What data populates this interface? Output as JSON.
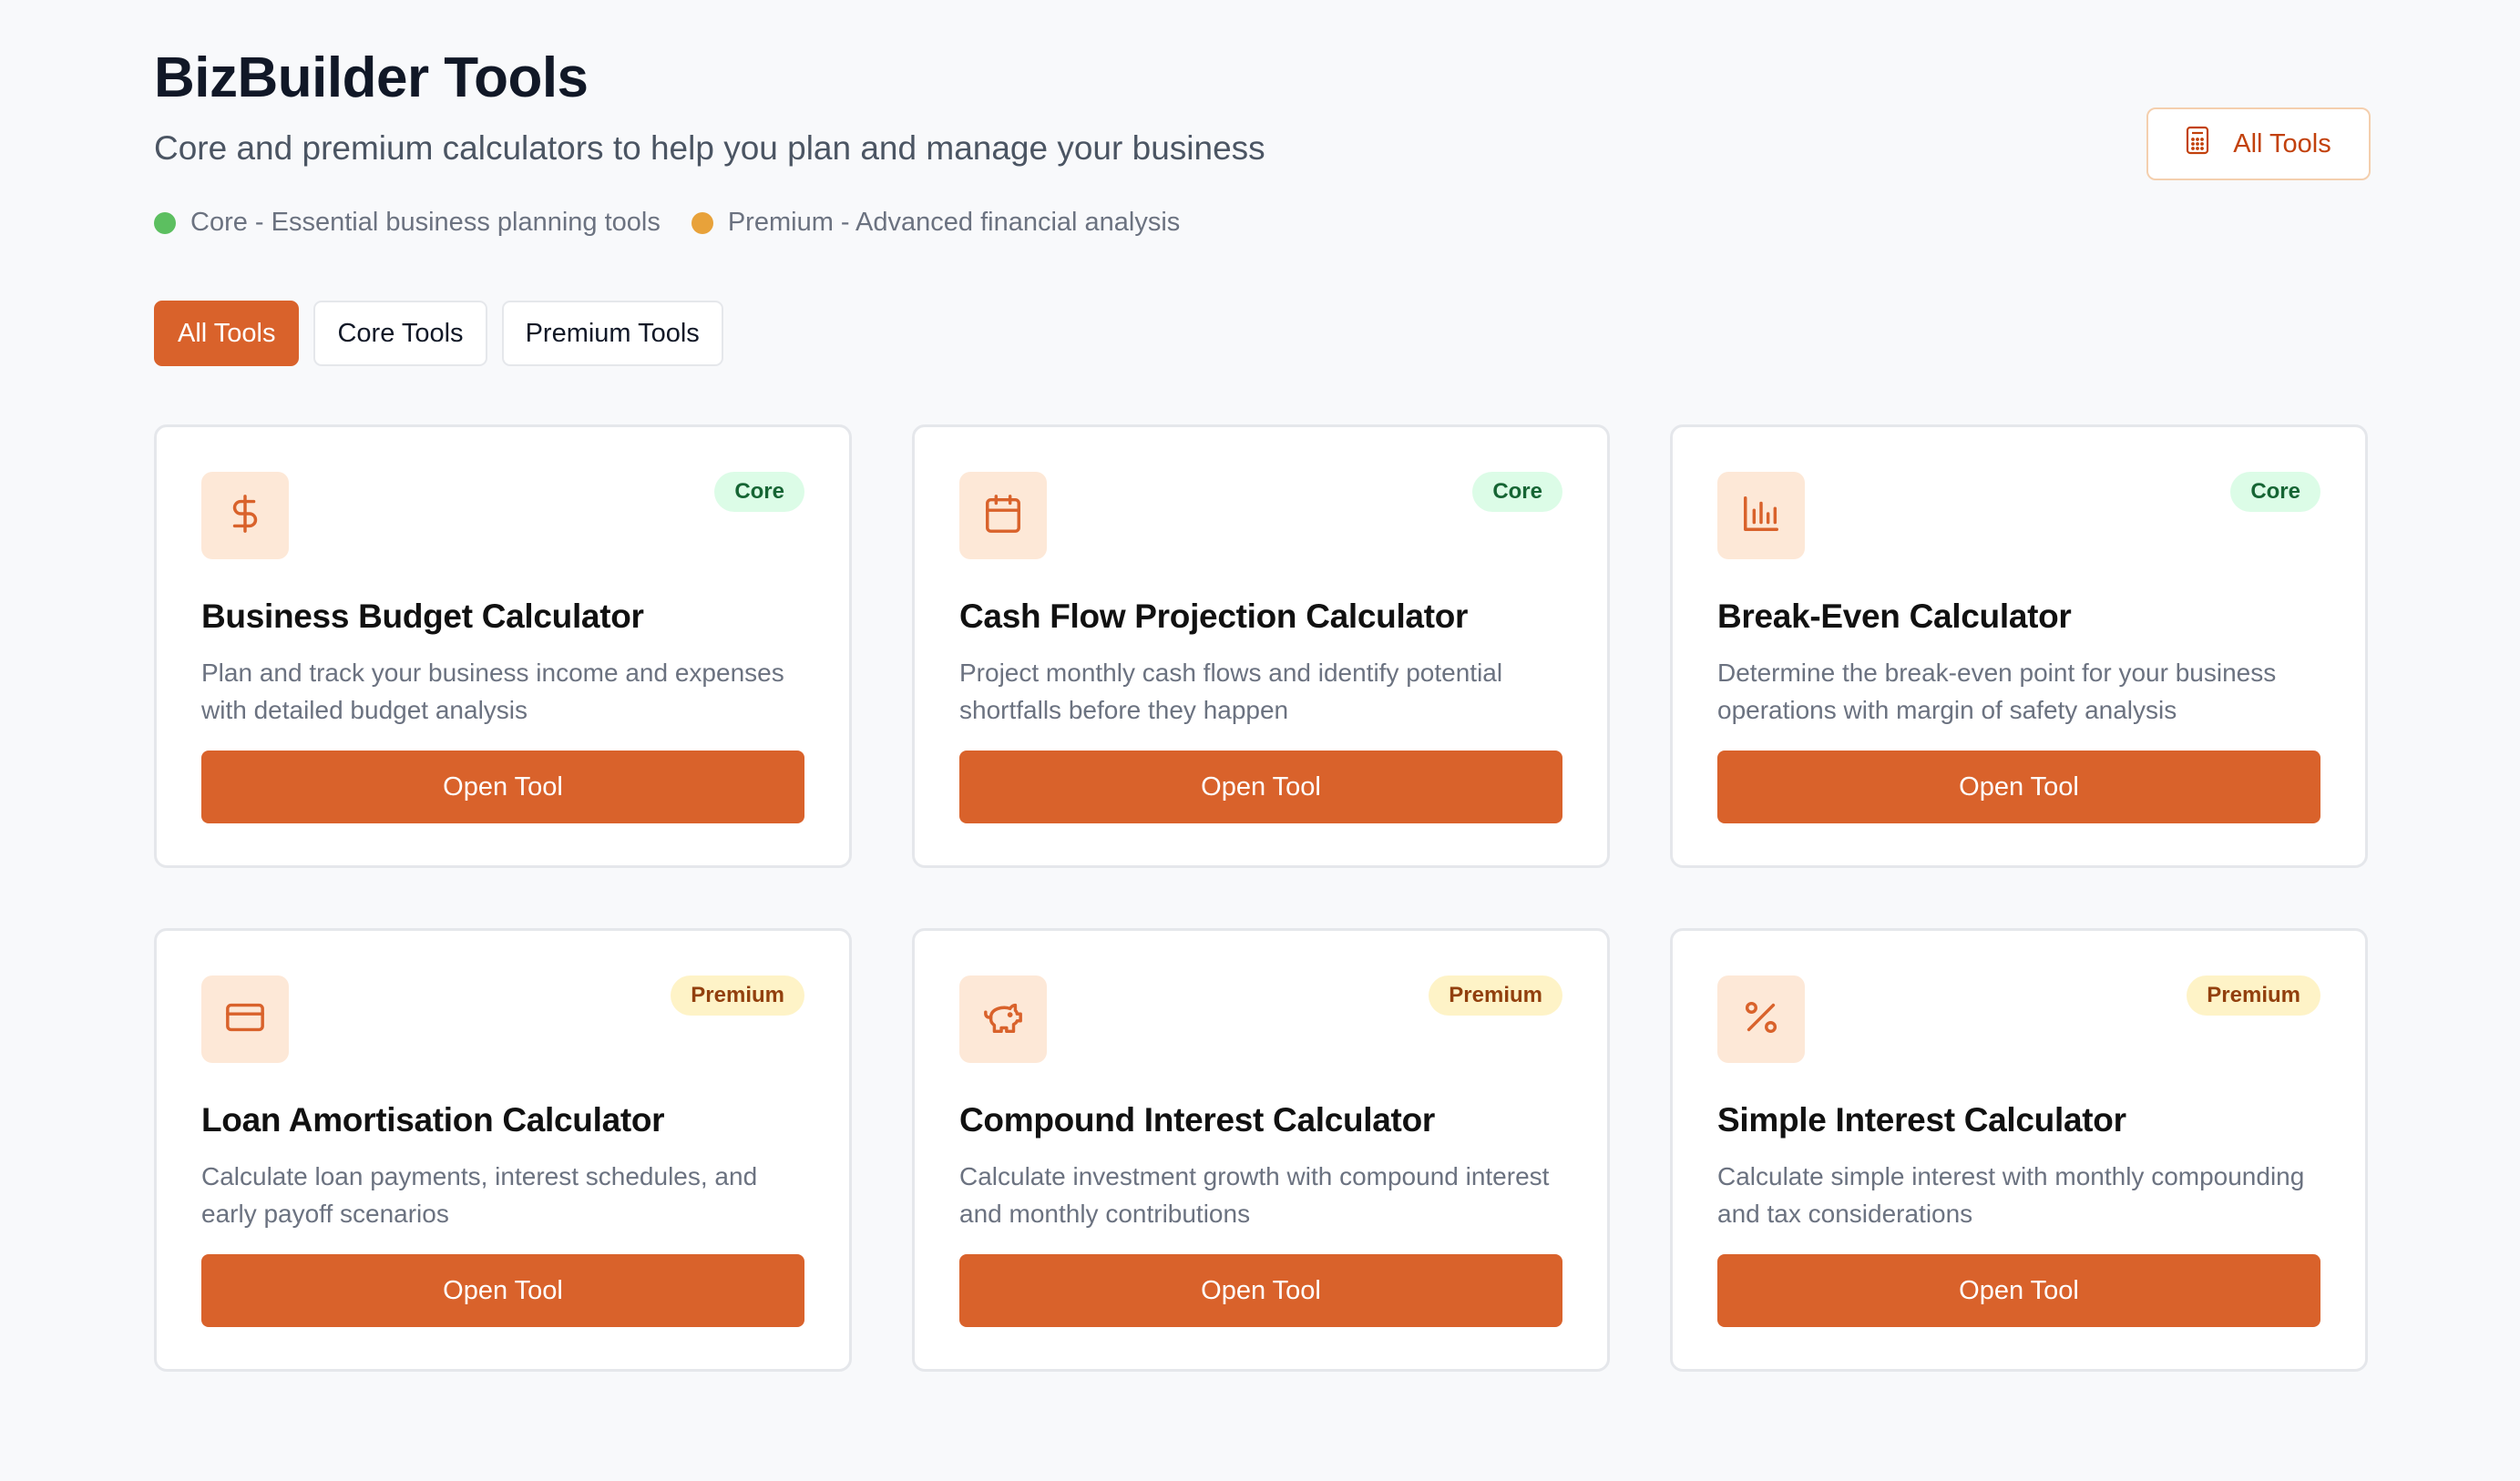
{
  "header": {
    "title": "BizBuilder Tools",
    "subtitle": "Core and premium calculators to help you plan and manage your business",
    "all_tools_button": "All Tools"
  },
  "legend": {
    "core": {
      "label": "Core - Essential business planning tools",
      "color": "#5cbf60"
    },
    "premium": {
      "label": "Premium - Advanced financial analysis",
      "color": "#e8a23a"
    }
  },
  "filters": [
    {
      "label": "All Tools",
      "active": true
    },
    {
      "label": "Core Tools",
      "active": false
    },
    {
      "label": "Premium Tools",
      "active": false
    }
  ],
  "tools": [
    {
      "icon": "dollar-icon",
      "badge": "Core",
      "tier": "core",
      "title": "Business Budget Calculator",
      "description": "Plan and track your business income and expenses with detailed budget analysis",
      "button": "Open Tool"
    },
    {
      "icon": "calendar-icon",
      "badge": "Core",
      "tier": "core",
      "title": "Cash Flow Projection Calculator",
      "description": "Project monthly cash flows and identify potential shortfalls before they happen",
      "button": "Open Tool"
    },
    {
      "icon": "bar-chart-icon",
      "badge": "Core",
      "tier": "core",
      "title": "Break-Even Calculator",
      "description": "Determine the break-even point for your business operations with margin of safety analysis",
      "button": "Open Tool"
    },
    {
      "icon": "credit-card-icon",
      "badge": "Premium",
      "tier": "premium",
      "title": "Loan Amortisation Calculator",
      "description": "Calculate loan payments, interest schedules, and early payoff scenarios",
      "button": "Open Tool"
    },
    {
      "icon": "piggy-bank-icon",
      "badge": "Premium",
      "tier": "premium",
      "title": "Compound Interest Calculator",
      "description": "Calculate investment growth with compound interest and monthly contributions",
      "button": "Open Tool"
    },
    {
      "icon": "percent-icon",
      "badge": "Premium",
      "tier": "premium",
      "title": "Simple Interest Calculator",
      "description": "Calculate simple interest with monthly compounding and tax considerations",
      "button": "Open Tool"
    }
  ],
  "colors": {
    "accent": "#d9622b",
    "icon_bg": "#fde8d7",
    "core_badge_bg": "#dcfce7",
    "premium_badge_bg": "#fef3c7"
  }
}
